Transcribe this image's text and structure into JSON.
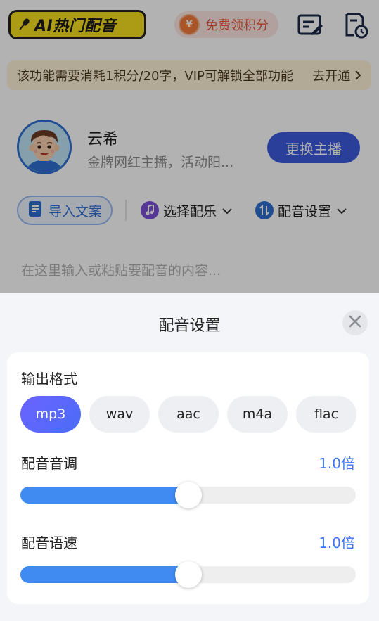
{
  "header": {
    "logo_text": "AI热门配音",
    "points_label": "免费领积分"
  },
  "notice": {
    "text": "该功能需要消耗1积分/20字，VIP可解锁全部功能",
    "link": "去开通"
  },
  "anchor": {
    "name": "云希",
    "description": "金牌网红主播，活动阳...",
    "change_button": "更换主播"
  },
  "actions": {
    "import": "导入文案",
    "music": "选择配乐",
    "settings": "配音设置"
  },
  "editor": {
    "placeholder": "在这里输入或粘贴要配音的内容..."
  },
  "sheet": {
    "title": "配音设置",
    "output_format_label": "输出格式",
    "formats": [
      "mp3",
      "wav",
      "aac",
      "m4a",
      "flac"
    ],
    "selected_format": "mp3",
    "pitch": {
      "label": "配音音调",
      "value_text": "1.0倍",
      "level": 0.5
    },
    "speed": {
      "label": "配音语速",
      "value_text": "1.0倍",
      "level": 0.5
    }
  },
  "colors": {
    "accent": "#3f73f2",
    "slider_fill": "#3f8bf2",
    "format_active": "#5b66f8",
    "logo_yellow": "#f7df1e"
  },
  "icons": [
    "microphone-icon",
    "coin-icon",
    "edit-document-icon",
    "history-icon",
    "document-icon",
    "music-note-icon",
    "settings-arrows-icon",
    "chevron-down-icon",
    "chevron-right-icon",
    "close-icon"
  ]
}
